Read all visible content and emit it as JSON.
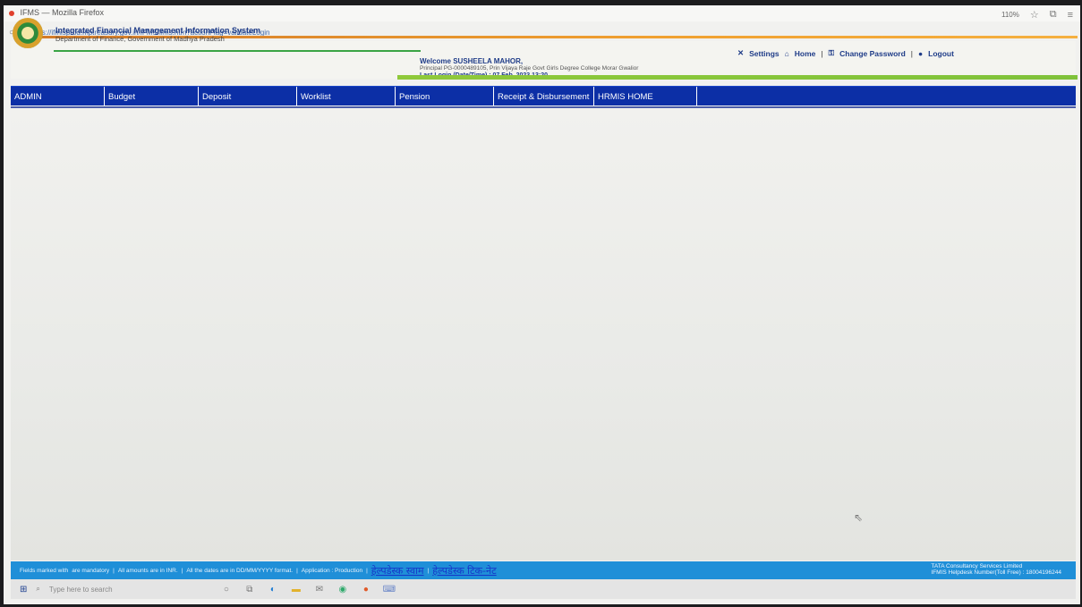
{
  "browser": {
    "window_title": "IFMS — Mozilla Firefox",
    "url": "https://ifmisprod.mptreasury.gov.in/IFMS/ifms.htm?actionFlag=validateLogin",
    "zoom": "110%"
  },
  "header": {
    "title": "Integrated Financial Management Information System",
    "subtitle": "Department of Finance, Government of Madhya Pradesh",
    "welcome": "Welcome SUSHEELA MAHOR,",
    "principal": "Principal PG-0000489105, Prin Vijaya Raje Govt Girls Degree College Morar Gwalior",
    "last_login": "Last Login (Date/Time) : 07 Feb, 2023 13:20",
    "links": {
      "settings": "Settings",
      "home": "Home",
      "change_password": "Change Password",
      "logout": "Logout"
    }
  },
  "nav": {
    "items": [
      {
        "label": "ADMIN"
      },
      {
        "label": "Budget"
      },
      {
        "label": "Deposit"
      },
      {
        "label": "Worklist"
      },
      {
        "label": "Pension"
      },
      {
        "label": "Receipt & Disbursement"
      },
      {
        "label": "HRMIS HOME"
      }
    ]
  },
  "footer": {
    "fields_note": "Fields marked with",
    "mandatory": "are mandatory",
    "amounts": "All amounts are in INR.",
    "dates": "All the dates are in DD/MM/YYYY format.",
    "application": "Application : Production",
    "helpdesk_hindi": "हेल्पडेस्क स्वाम",
    "helpdesk_ticket_hindi": "हेल्पडेस्क टिक-नेट",
    "vendor": "TATA Consultancy Services Limited",
    "helpdesk_number": "IFMIS Helpdesk Number(Toll Free) : 18004196244"
  },
  "taskbar": {
    "search_placeholder": "Type here to search"
  },
  "colors": {
    "nav_bg": "#0c2fa6",
    "footer_bg": "#1f8fd8",
    "accent_orange": "#f0a030",
    "accent_green": "#3aa445"
  }
}
